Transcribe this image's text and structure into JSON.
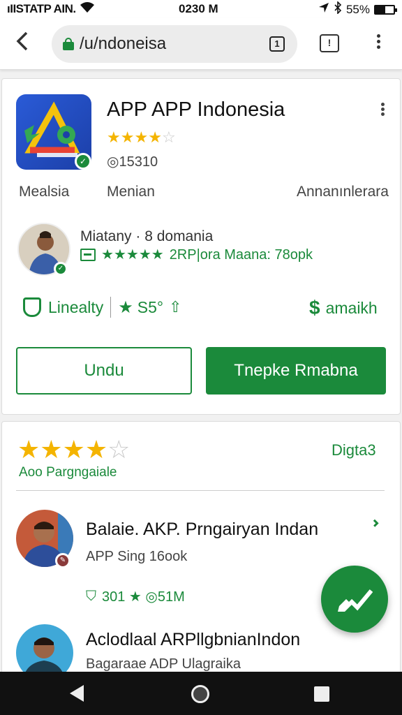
{
  "status_bar": {
    "carrier": "ıIISTATP AIN.",
    "time": "0230 M",
    "battery": "55%",
    "battery_level": 0.55
  },
  "browser": {
    "url": "/u/ndoneisa",
    "tab_count": "1",
    "feedback_label": "!"
  },
  "app": {
    "title": "APP APP Indonesia",
    "rating": 3.5,
    "downloads": "◎15310",
    "tabs": [
      "Mealsia",
      "Menian",
      "Annanınlerara"
    ],
    "developer_meta": "Miatany · 8 domania",
    "developer_rating_text": "2RP|ora Maana: 78opk",
    "features": {
      "left_label": "Linealty",
      "rating_label": "S5°",
      "right_label": "amaikh"
    },
    "buttons": {
      "install": "Undu",
      "primary": "Tnepke Rmabna"
    }
  },
  "reviews": {
    "rating": 4,
    "subtitle": "Aoo Pargngaiale",
    "link": "Digta3",
    "items": [
      {
        "title": "Balaie. AKP. Prngairyan Indan",
        "subtitle": "APP Sing 16ook",
        "stats": "301 ★ ◎51M"
      },
      {
        "title": "Aclodlaal ARPllgbnianIndon",
        "subtitle": "Bagaraae ADP Ulagraika"
      }
    ]
  },
  "colors": {
    "accent": "#1b8a3b",
    "star": "#f4b400"
  },
  "icons": {
    "fab": "edit-check-icon"
  }
}
